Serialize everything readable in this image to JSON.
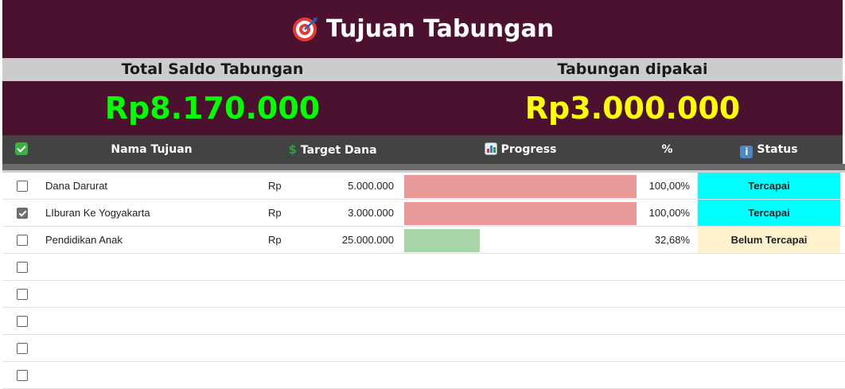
{
  "title": "Tujuan Tabungan",
  "summary": {
    "total_label": "Total Saldo Tabungan",
    "total_value": "Rp8.170.000",
    "used_label": "Tabungan dipakai",
    "used_value": "Rp3.000.000"
  },
  "columns": {
    "check": "",
    "name": "Nama Tujuan",
    "target": "Target Dana",
    "progress": "Progress",
    "pct": "%",
    "status": "Status"
  },
  "colors": {
    "header_bg": "#4d1130",
    "total_value": "#00ff00",
    "used_value": "#ffff00",
    "bar_done": "#ea9999",
    "bar_partial": "#a8d5a8",
    "status_done": "#00ffff",
    "status_pending": "#fff2cc"
  },
  "rows": [
    {
      "checked": true,
      "name": "Dana Darurat",
      "currency": "Rp",
      "target": "5.000.000",
      "progress": 1.0,
      "pct": "100,00%",
      "status": "Tercapai",
      "state": "done",
      "checked_box": false
    },
    {
      "checked": true,
      "name": "LIburan Ke Yogyakarta",
      "currency": "Rp",
      "target": "3.000.000",
      "progress": 1.0,
      "pct": "100,00%",
      "status": "Tercapai",
      "state": "done",
      "checked_box": true
    },
    {
      "checked": false,
      "name": "Pendidikan Anak",
      "currency": "Rp",
      "target": "25.000.000",
      "progress": 0.3268,
      "pct": "32,68%",
      "status": "Belum Tercapai",
      "state": "pending",
      "checked_box": false
    },
    {
      "checked": false,
      "name": "",
      "currency": "",
      "target": "",
      "progress": 0,
      "pct": "",
      "status": "",
      "state": "empty",
      "checked_box": false
    },
    {
      "checked": false,
      "name": "",
      "currency": "",
      "target": "",
      "progress": 0,
      "pct": "",
      "status": "",
      "state": "empty",
      "checked_box": false
    },
    {
      "checked": false,
      "name": "",
      "currency": "",
      "target": "",
      "progress": 0,
      "pct": "",
      "status": "",
      "state": "empty",
      "checked_box": false
    },
    {
      "checked": false,
      "name": "",
      "currency": "",
      "target": "",
      "progress": 0,
      "pct": "",
      "status": "",
      "state": "empty",
      "checked_box": false
    },
    {
      "checked": false,
      "name": "",
      "currency": "",
      "target": "",
      "progress": 0,
      "pct": "",
      "status": "",
      "state": "empty",
      "checked_box": false
    }
  ]
}
